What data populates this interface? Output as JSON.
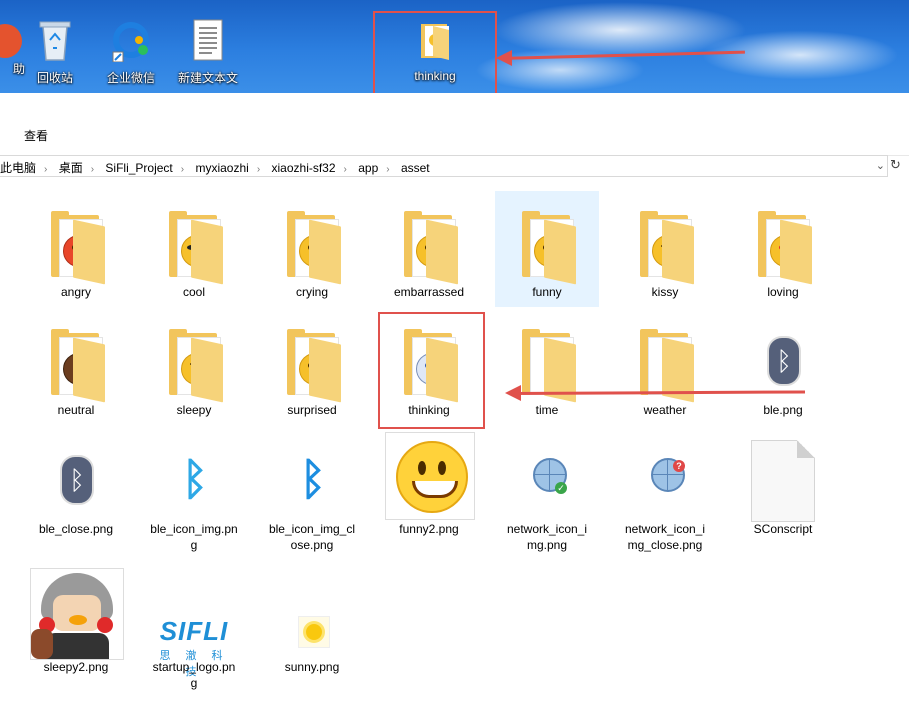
{
  "desktop": {
    "icons": [
      {
        "label": "助",
        "icon": "help-icon"
      },
      {
        "label": "回收站",
        "icon": "recycle-bin-icon"
      },
      {
        "label": "企业微信",
        "icon": "wecom-icon"
      },
      {
        "label": "新建文本文",
        "icon": "text-file-icon"
      },
      {
        "label": "thinking",
        "icon": "folder-icon"
      }
    ]
  },
  "ribbon": {
    "view_tab": "查看"
  },
  "address_bar": {
    "crumbs": [
      "此电脑",
      "桌面",
      "SiFli_Project",
      "myxiaozhi",
      "xiaozhi-sf32",
      "app",
      "asset"
    ],
    "dropdown": "⌄",
    "refresh": "↻"
  },
  "files": [
    {
      "name": "angry",
      "type": "folder",
      "emoji": "angry"
    },
    {
      "name": "cool",
      "type": "folder",
      "emoji": "cool"
    },
    {
      "name": "crying",
      "type": "folder",
      "emoji": "crying"
    },
    {
      "name": "embarrassed",
      "type": "folder",
      "emoji": "embarrassed"
    },
    {
      "name": "funny",
      "type": "folder",
      "emoji": "funny",
      "selected": true
    },
    {
      "name": "kissy",
      "type": "folder",
      "emoji": "kissy"
    },
    {
      "name": "loving",
      "type": "folder",
      "emoji": "loving"
    },
    {
      "name": "neutral",
      "type": "folder",
      "emoji": "neutral"
    },
    {
      "name": "sleepy",
      "type": "folder",
      "emoji": "sleepy"
    },
    {
      "name": "surprised",
      "type": "folder",
      "emoji": "surprised"
    },
    {
      "name": "thinking",
      "type": "folder",
      "emoji": "thinking"
    },
    {
      "name": "time",
      "type": "folder",
      "emoji": "none"
    },
    {
      "name": "weather",
      "type": "folder",
      "emoji": "none"
    },
    {
      "name": "ble.png",
      "type": "image",
      "icon": "bluetooth-icon"
    },
    {
      "name": "ble_close.png",
      "type": "image",
      "icon": "bluetooth-icon"
    },
    {
      "name": "ble_icon_img.pn\ng",
      "type": "image",
      "icon": "bluetooth-icon"
    },
    {
      "name": "ble_icon_img_cl\nose.png",
      "type": "image",
      "icon": "bluetooth-icon"
    },
    {
      "name": "funny2.png",
      "type": "image",
      "icon": "smiley-icon"
    },
    {
      "name": "network_icon_i\nmg.png",
      "type": "image",
      "icon": "globe-icon"
    },
    {
      "name": "network_icon_i\nmg_close.png",
      "type": "image",
      "icon": "globe-icon"
    },
    {
      "name": "SConscript",
      "type": "file",
      "icon": "document-icon"
    },
    {
      "name": "sleepy2.png",
      "type": "image",
      "icon": "avatar-icon"
    },
    {
      "name": "startup_logo.pn\ng",
      "type": "image",
      "icon": "sifli-logo-icon"
    },
    {
      "name": "sunny.png",
      "type": "image",
      "icon": "sun-icon"
    }
  ],
  "logo_text": {
    "title": "SIFLI",
    "subtitle": "思 澈 科 技"
  },
  "colors": {
    "highlight": "#e0514c",
    "selected_bg": "#e5f3ff",
    "folder": "#f2c55c"
  }
}
